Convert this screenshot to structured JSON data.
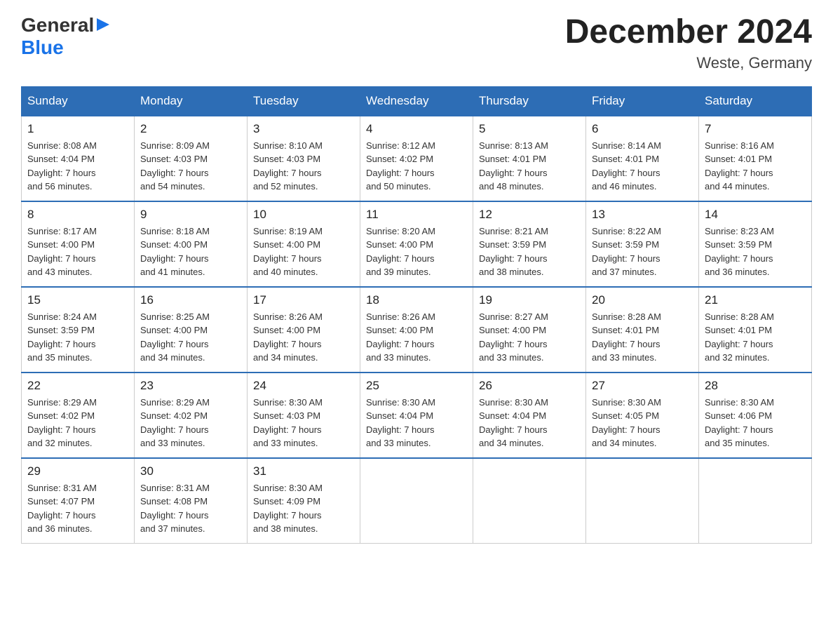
{
  "header": {
    "logo": {
      "general": "General",
      "blue": "Blue",
      "triangle": "▶"
    },
    "title": "December 2024",
    "subtitle": "Weste, Germany"
  },
  "days_of_week": [
    "Sunday",
    "Monday",
    "Tuesday",
    "Wednesday",
    "Thursday",
    "Friday",
    "Saturday"
  ],
  "weeks": [
    [
      {
        "day": "1",
        "sunrise": "Sunrise: 8:08 AM",
        "sunset": "Sunset: 4:04 PM",
        "daylight": "Daylight: 7 hours",
        "minutes": "and 56 minutes."
      },
      {
        "day": "2",
        "sunrise": "Sunrise: 8:09 AM",
        "sunset": "Sunset: 4:03 PM",
        "daylight": "Daylight: 7 hours",
        "minutes": "and 54 minutes."
      },
      {
        "day": "3",
        "sunrise": "Sunrise: 8:10 AM",
        "sunset": "Sunset: 4:03 PM",
        "daylight": "Daylight: 7 hours",
        "minutes": "and 52 minutes."
      },
      {
        "day": "4",
        "sunrise": "Sunrise: 8:12 AM",
        "sunset": "Sunset: 4:02 PM",
        "daylight": "Daylight: 7 hours",
        "minutes": "and 50 minutes."
      },
      {
        "day": "5",
        "sunrise": "Sunrise: 8:13 AM",
        "sunset": "Sunset: 4:01 PM",
        "daylight": "Daylight: 7 hours",
        "minutes": "and 48 minutes."
      },
      {
        "day": "6",
        "sunrise": "Sunrise: 8:14 AM",
        "sunset": "Sunset: 4:01 PM",
        "daylight": "Daylight: 7 hours",
        "minutes": "and 46 minutes."
      },
      {
        "day": "7",
        "sunrise": "Sunrise: 8:16 AM",
        "sunset": "Sunset: 4:01 PM",
        "daylight": "Daylight: 7 hours",
        "minutes": "and 44 minutes."
      }
    ],
    [
      {
        "day": "8",
        "sunrise": "Sunrise: 8:17 AM",
        "sunset": "Sunset: 4:00 PM",
        "daylight": "Daylight: 7 hours",
        "minutes": "and 43 minutes."
      },
      {
        "day": "9",
        "sunrise": "Sunrise: 8:18 AM",
        "sunset": "Sunset: 4:00 PM",
        "daylight": "Daylight: 7 hours",
        "minutes": "and 41 minutes."
      },
      {
        "day": "10",
        "sunrise": "Sunrise: 8:19 AM",
        "sunset": "Sunset: 4:00 PM",
        "daylight": "Daylight: 7 hours",
        "minutes": "and 40 minutes."
      },
      {
        "day": "11",
        "sunrise": "Sunrise: 8:20 AM",
        "sunset": "Sunset: 4:00 PM",
        "daylight": "Daylight: 7 hours",
        "minutes": "and 39 minutes."
      },
      {
        "day": "12",
        "sunrise": "Sunrise: 8:21 AM",
        "sunset": "Sunset: 3:59 PM",
        "daylight": "Daylight: 7 hours",
        "minutes": "and 38 minutes."
      },
      {
        "day": "13",
        "sunrise": "Sunrise: 8:22 AM",
        "sunset": "Sunset: 3:59 PM",
        "daylight": "Daylight: 7 hours",
        "minutes": "and 37 minutes."
      },
      {
        "day": "14",
        "sunrise": "Sunrise: 8:23 AM",
        "sunset": "Sunset: 3:59 PM",
        "daylight": "Daylight: 7 hours",
        "minutes": "and 36 minutes."
      }
    ],
    [
      {
        "day": "15",
        "sunrise": "Sunrise: 8:24 AM",
        "sunset": "Sunset: 3:59 PM",
        "daylight": "Daylight: 7 hours",
        "minutes": "and 35 minutes."
      },
      {
        "day": "16",
        "sunrise": "Sunrise: 8:25 AM",
        "sunset": "Sunset: 4:00 PM",
        "daylight": "Daylight: 7 hours",
        "minutes": "and 34 minutes."
      },
      {
        "day": "17",
        "sunrise": "Sunrise: 8:26 AM",
        "sunset": "Sunset: 4:00 PM",
        "daylight": "Daylight: 7 hours",
        "minutes": "and 34 minutes."
      },
      {
        "day": "18",
        "sunrise": "Sunrise: 8:26 AM",
        "sunset": "Sunset: 4:00 PM",
        "daylight": "Daylight: 7 hours",
        "minutes": "and 33 minutes."
      },
      {
        "day": "19",
        "sunrise": "Sunrise: 8:27 AM",
        "sunset": "Sunset: 4:00 PM",
        "daylight": "Daylight: 7 hours",
        "minutes": "and 33 minutes."
      },
      {
        "day": "20",
        "sunrise": "Sunrise: 8:28 AM",
        "sunset": "Sunset: 4:01 PM",
        "daylight": "Daylight: 7 hours",
        "minutes": "and 33 minutes."
      },
      {
        "day": "21",
        "sunrise": "Sunrise: 8:28 AM",
        "sunset": "Sunset: 4:01 PM",
        "daylight": "Daylight: 7 hours",
        "minutes": "and 32 minutes."
      }
    ],
    [
      {
        "day": "22",
        "sunrise": "Sunrise: 8:29 AM",
        "sunset": "Sunset: 4:02 PM",
        "daylight": "Daylight: 7 hours",
        "minutes": "and 32 minutes."
      },
      {
        "day": "23",
        "sunrise": "Sunrise: 8:29 AM",
        "sunset": "Sunset: 4:02 PM",
        "daylight": "Daylight: 7 hours",
        "minutes": "and 33 minutes."
      },
      {
        "day": "24",
        "sunrise": "Sunrise: 8:30 AM",
        "sunset": "Sunset: 4:03 PM",
        "daylight": "Daylight: 7 hours",
        "minutes": "and 33 minutes."
      },
      {
        "day": "25",
        "sunrise": "Sunrise: 8:30 AM",
        "sunset": "Sunset: 4:04 PM",
        "daylight": "Daylight: 7 hours",
        "minutes": "and 33 minutes."
      },
      {
        "day": "26",
        "sunrise": "Sunrise: 8:30 AM",
        "sunset": "Sunset: 4:04 PM",
        "daylight": "Daylight: 7 hours",
        "minutes": "and 34 minutes."
      },
      {
        "day": "27",
        "sunrise": "Sunrise: 8:30 AM",
        "sunset": "Sunset: 4:05 PM",
        "daylight": "Daylight: 7 hours",
        "minutes": "and 34 minutes."
      },
      {
        "day": "28",
        "sunrise": "Sunrise: 8:30 AM",
        "sunset": "Sunset: 4:06 PM",
        "daylight": "Daylight: 7 hours",
        "minutes": "and 35 minutes."
      }
    ],
    [
      {
        "day": "29",
        "sunrise": "Sunrise: 8:31 AM",
        "sunset": "Sunset: 4:07 PM",
        "daylight": "Daylight: 7 hours",
        "minutes": "and 36 minutes."
      },
      {
        "day": "30",
        "sunrise": "Sunrise: 8:31 AM",
        "sunset": "Sunset: 4:08 PM",
        "daylight": "Daylight: 7 hours",
        "minutes": "and 37 minutes."
      },
      {
        "day": "31",
        "sunrise": "Sunrise: 8:30 AM",
        "sunset": "Sunset: 4:09 PM",
        "daylight": "Daylight: 7 hours",
        "minutes": "and 38 minutes."
      },
      null,
      null,
      null,
      null
    ]
  ]
}
